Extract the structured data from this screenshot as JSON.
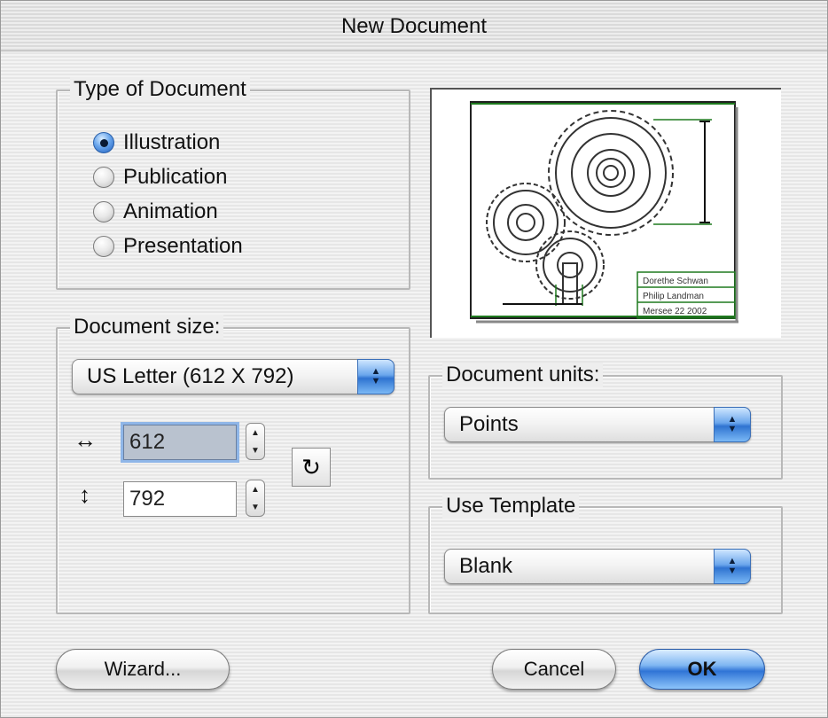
{
  "window": {
    "title": "New Document"
  },
  "doc_type": {
    "legend": "Type of Document",
    "options": [
      {
        "label": "Illustration",
        "selected": true
      },
      {
        "label": "Publication",
        "selected": false
      },
      {
        "label": "Animation",
        "selected": false
      },
      {
        "label": "Presentation",
        "selected": false
      }
    ]
  },
  "doc_size": {
    "legend": "Document size:",
    "preset": "US Letter (612 X 792)",
    "width_value": "612",
    "height_value": "792",
    "width_icon": "horizontal-arrows-icon",
    "height_icon": "vertical-arrows-icon",
    "swap_icon": "rotate-icon"
  },
  "doc_units": {
    "legend": "Document units:",
    "value": "Points"
  },
  "template": {
    "legend": "Use Template",
    "value": "Blank"
  },
  "preview": {
    "title_block": [
      "Dorethe Schwan",
      "Philip Landman",
      "Mersee 22 2002"
    ]
  },
  "buttons": {
    "wizard": "Wizard...",
    "cancel": "Cancel",
    "ok": "OK"
  },
  "colors": {
    "accent": "#2f74d6",
    "preview_line": "#1e7a1e"
  }
}
